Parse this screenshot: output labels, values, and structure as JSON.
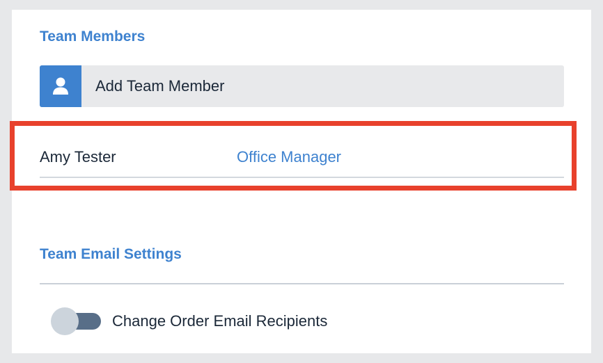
{
  "team_members": {
    "title": "Team Members",
    "add_button": {
      "label": "Add Team Member",
      "icon": "user-icon"
    },
    "members": [
      {
        "name": "Amy Tester",
        "role": "Office Manager"
      }
    ]
  },
  "email_settings": {
    "title": "Team Email Settings",
    "toggles": [
      {
        "label": "Change Order Email Recipients",
        "state": "off"
      }
    ]
  },
  "colors": {
    "accent": "#3e82cf",
    "highlight": "#e8412c",
    "text": "#1b2838",
    "background": "#e7e8ea",
    "toggle_track": "#586e88",
    "toggle_knob": "#ccd4dc"
  }
}
